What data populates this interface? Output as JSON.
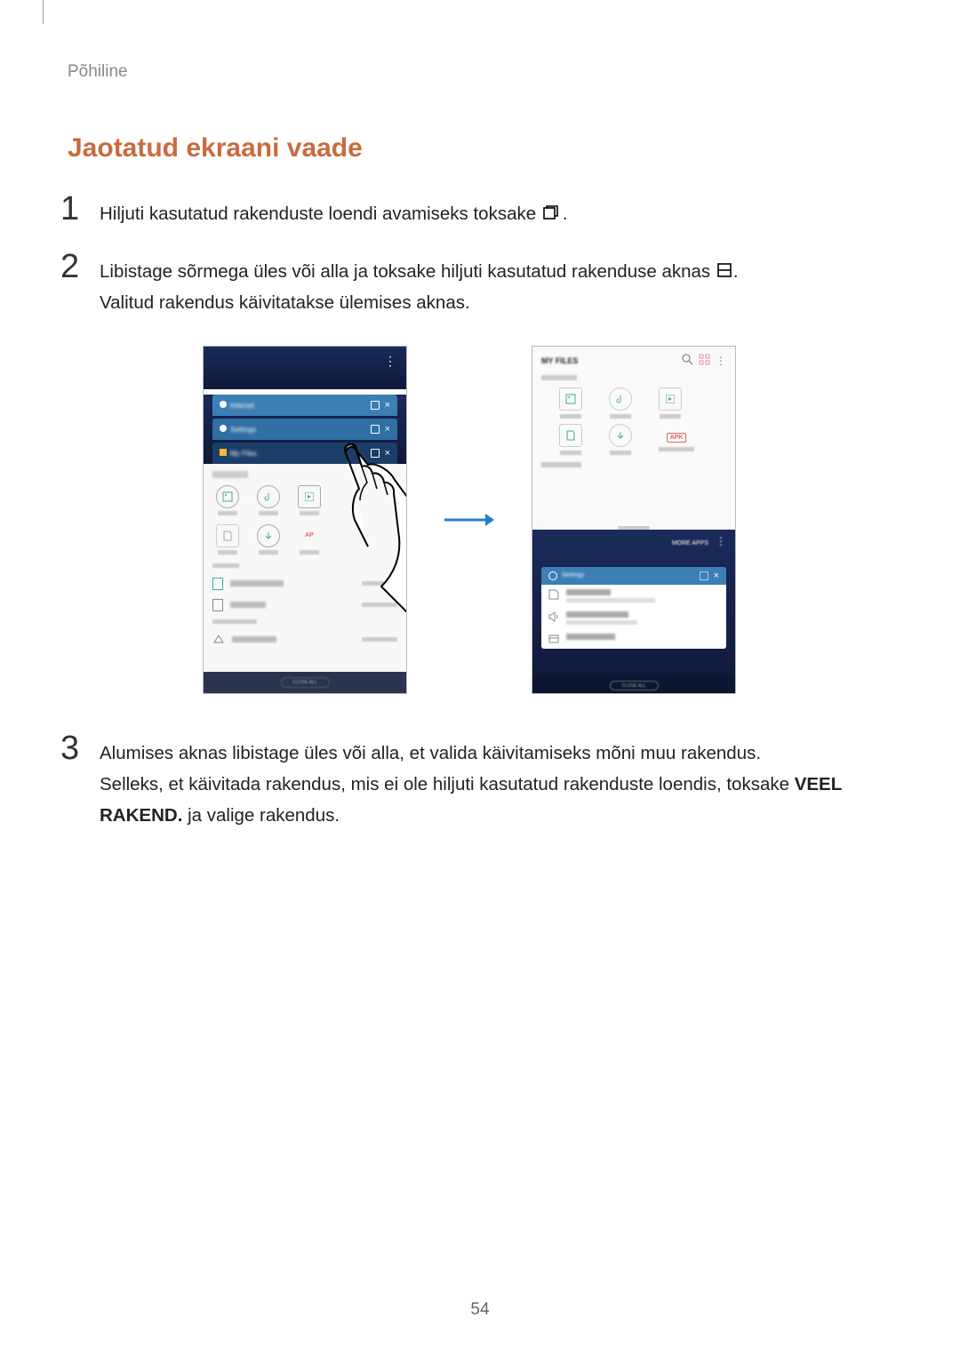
{
  "section_label": "Põhiline",
  "title": "Jaotatud ekraani vaade",
  "step1": {
    "num": "1",
    "text_before": "Hiljuti kasutatud rakenduste loendi avamiseks toksake ",
    "text_after": "."
  },
  "step2": {
    "num": "2",
    "line1_before": "Libistage sõrmega üles või alla ja toksake hiljuti kasutatud rakenduse aknas ",
    "line1_after": ".",
    "line2": "Valitud rakendus käivitatakse ülemises aknas."
  },
  "step3": {
    "num": "3",
    "line1": "Alumises aknas libistage üles või alla, et valida käivitamiseks mõni muu rakendus.",
    "line2_a": "Selleks, et käivitada rakendus, mis ei ole hiljuti kasutatud rakenduste loendis, toksake ",
    "line2_bold": "VEEL RAKEND.",
    "line2_b": " ja valige rakendus."
  },
  "page_number": "54",
  "figure": {
    "apk": "APK",
    "close_all": "CLOSE ALL"
  }
}
